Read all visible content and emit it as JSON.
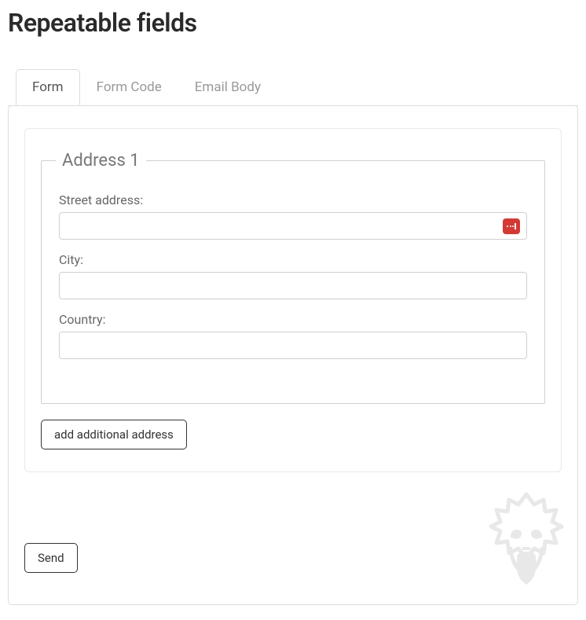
{
  "page": {
    "title": "Repeatable fields"
  },
  "tabs": [
    {
      "label": "Form",
      "active": true
    },
    {
      "label": "Form Code",
      "active": false
    },
    {
      "label": "Email Body",
      "active": false
    }
  ],
  "address": {
    "legend": "Address 1",
    "fields": {
      "street": {
        "label": "Street address:",
        "value": ""
      },
      "city": {
        "label": "City:",
        "value": ""
      },
      "country": {
        "label": "Country:",
        "value": ""
      }
    }
  },
  "buttons": {
    "add_address": "add additional address",
    "send": "Send"
  }
}
